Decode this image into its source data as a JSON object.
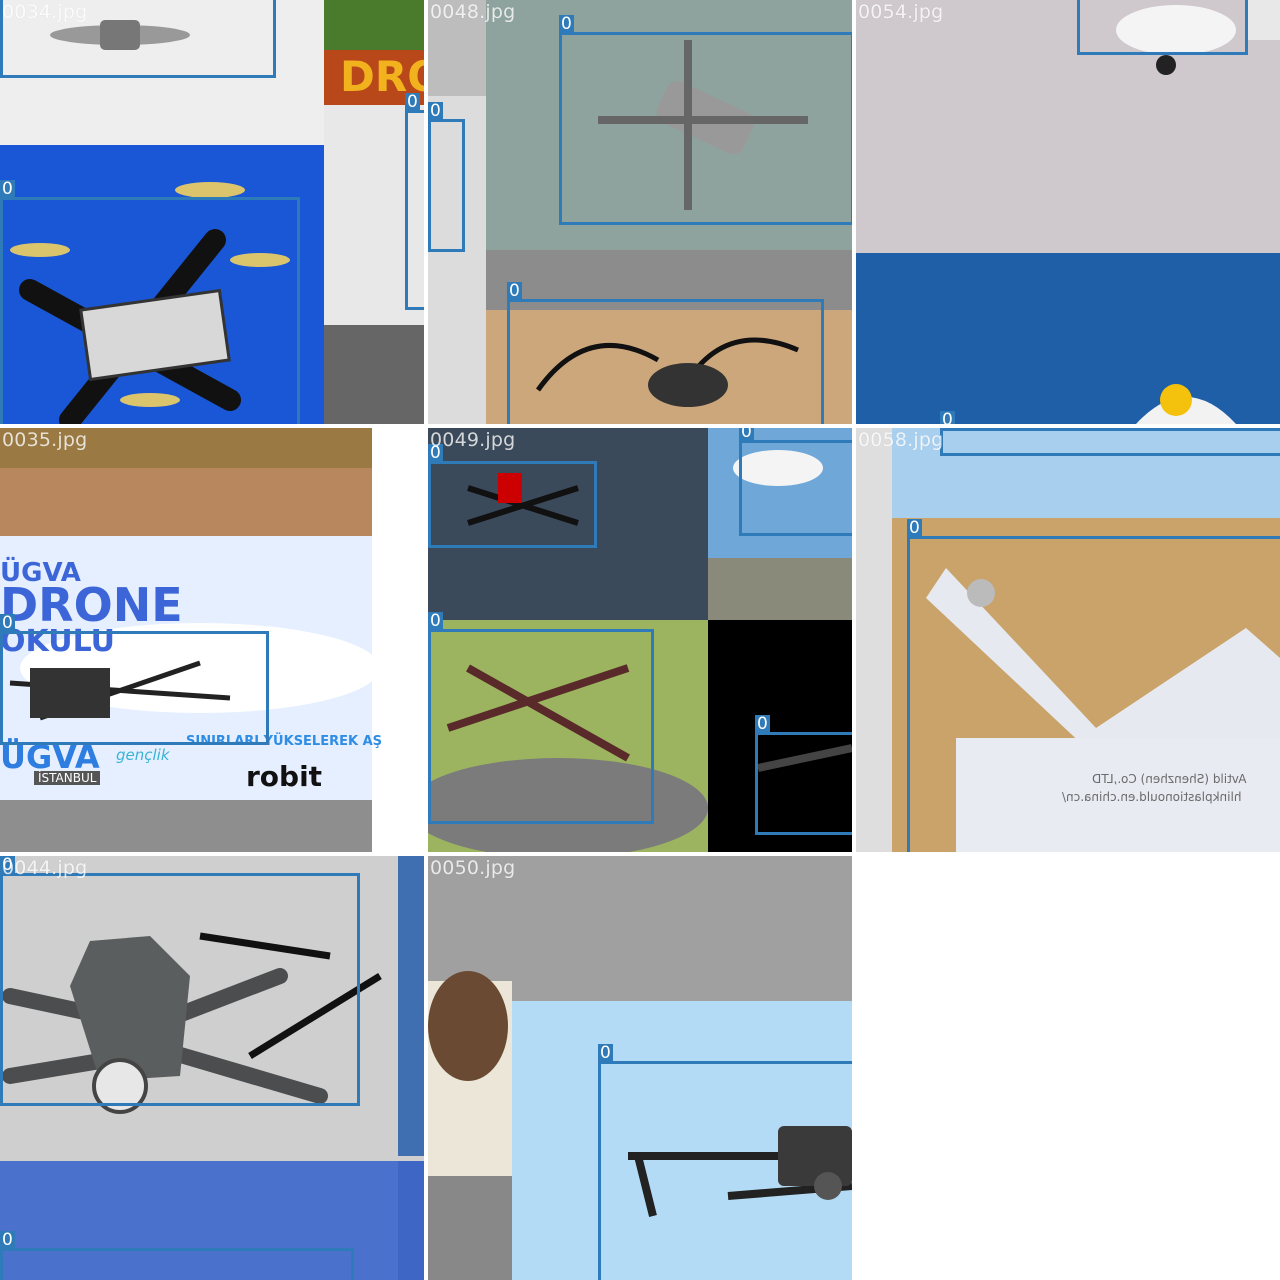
{
  "tiles": [
    {
      "filename": "0034.jpg",
      "class_label": "0"
    },
    {
      "filename": "0048.jpg",
      "class_label": "0"
    },
    {
      "filename": "0054.jpg",
      "class_label": "0"
    },
    {
      "filename": "0035.jpg",
      "class_label": "0"
    },
    {
      "filename": "0049.jpg",
      "class_label": "0"
    },
    {
      "filename": "0058.jpg",
      "class_label": "0"
    },
    {
      "filename": "0044.jpg",
      "class_label": "0"
    },
    {
      "filename": "0050.jpg",
      "class_label": "0"
    }
  ],
  "scene_text": {
    "dro": "DRO",
    "ugva": "ÜGVA",
    "drone": "DRONE",
    "okulu": "OKULU",
    "tagline": "SINIRLARI YÜKSELEREK AŞ",
    "istanbul": "İSTANBUL",
    "ugva_logo": "ÜGVA",
    "genclik": "gençlik",
    "robit": "robit",
    "factory_line1": "Avtild (Shenzhen) Co.,LTD",
    "factory_line2": "hlinkplastionould.en.china.cn/"
  },
  "colors": {
    "box": "#2f7ab8",
    "label_text": "#ffffff"
  }
}
